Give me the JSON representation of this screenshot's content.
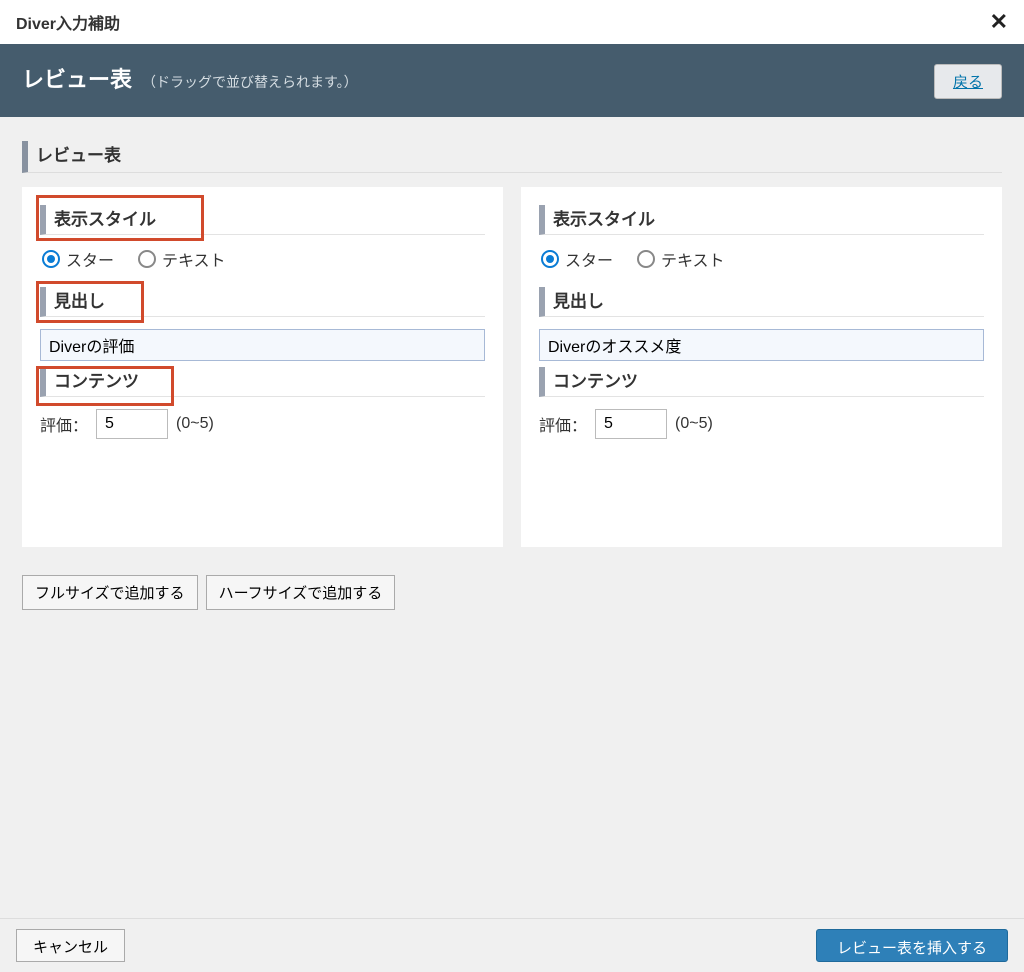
{
  "modal": {
    "title": "Diver入力補助"
  },
  "banner": {
    "title": "レビュー表",
    "subtitle": "（ドラッグで並び替えられます。）",
    "back": "戻る"
  },
  "section": {
    "title": "レビュー表"
  },
  "labels": {
    "display_style": "表示スタイル",
    "star": "スター",
    "text": "テキスト",
    "heading": "見出し",
    "contents": "コンテンツ",
    "rating_prefix": "評価：",
    "rating_range": "(0~5)"
  },
  "cards": [
    {
      "style_selected": "star",
      "heading_value": "Diverの評価",
      "rating_value": "5"
    },
    {
      "style_selected": "star",
      "heading_value": "Diverのオススメ度",
      "rating_value": "5"
    }
  ],
  "buttons": {
    "add_full": "フルサイズで追加する",
    "add_half": "ハーフサイズで追加する",
    "cancel": "キャンセル",
    "insert": "レビュー表を挿入する"
  }
}
